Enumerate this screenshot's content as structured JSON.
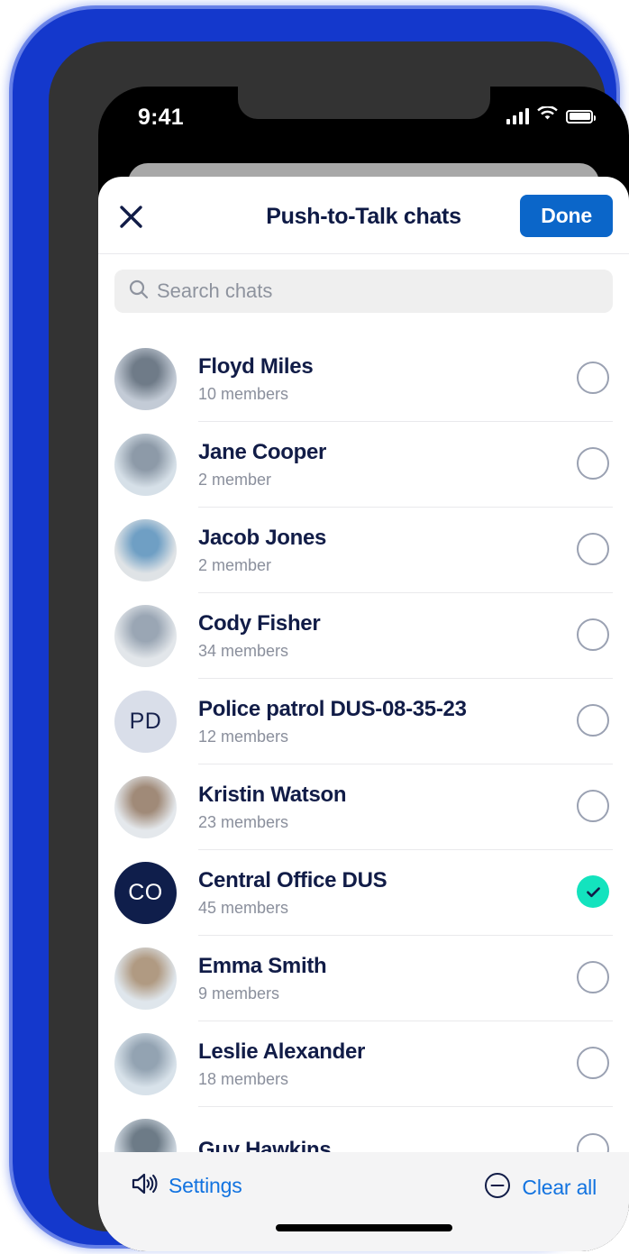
{
  "status_bar": {
    "time": "9:41",
    "signal_icon": "cellular-signal-icon",
    "wifi_icon": "wifi-icon",
    "battery_icon": "battery-icon"
  },
  "header": {
    "title": "Push-to-Talk chats",
    "close_icon": "close-icon",
    "done_label": "Done"
  },
  "search": {
    "placeholder": "Search chats",
    "value": "",
    "icon": "search-icon"
  },
  "chats": [
    {
      "name": "Floyd Miles",
      "members": "10 members",
      "selected": false,
      "avatar_type": "photo",
      "initials": "",
      "photo_a": "#c3cbd6",
      "photo_b": "#6f7b88"
    },
    {
      "name": "Jane Cooper",
      "members": "2 member",
      "selected": false,
      "avatar_type": "photo",
      "initials": "",
      "photo_a": "#d6e0e8",
      "photo_b": "#8d9aa8"
    },
    {
      "name": "Jacob Jones",
      "members": "2 member",
      "selected": false,
      "avatar_type": "photo",
      "initials": "",
      "photo_a": "#dfe3e6",
      "photo_b": "#6f9fc4"
    },
    {
      "name": "Cody Fisher",
      "members": "34 members",
      "selected": false,
      "avatar_type": "photo",
      "initials": "",
      "photo_a": "#e2e6ea",
      "photo_b": "#9aa6b4"
    },
    {
      "name": "Police patrol DUS-08-35-23",
      "members": "12 members",
      "selected": false,
      "avatar_type": "initials",
      "initials": "PD",
      "bg": "#D9DEE9",
      "fg": "#17224d"
    },
    {
      "name": "Kristin Watson",
      "members": "23 members",
      "selected": false,
      "avatar_type": "photo",
      "initials": "",
      "photo_a": "#e4e8ec",
      "photo_b": "#a08a78"
    },
    {
      "name": "Central Office DUS",
      "members": "45 members",
      "selected": true,
      "avatar_type": "initials",
      "initials": "CO",
      "bg": "#0F1E4B",
      "fg": "#ffffff"
    },
    {
      "name": "Emma Smith",
      "members": "9 members",
      "selected": false,
      "avatar_type": "photo",
      "initials": "",
      "photo_a": "#dfe6ec",
      "photo_b": "#b09a82"
    },
    {
      "name": "Leslie Alexander",
      "members": "18 members",
      "selected": false,
      "avatar_type": "photo",
      "initials": "",
      "photo_a": "#d8e2ea",
      "photo_b": "#93a3b2"
    },
    {
      "name": "Guy Hawkins",
      "members": "",
      "selected": false,
      "avatar_type": "photo",
      "initials": "",
      "photo_a": "#ccd5de",
      "photo_b": "#6d7b87"
    }
  ],
  "bottom_bar": {
    "settings_label": "Settings",
    "settings_icon": "speaker-volume-icon",
    "clear_all_label": "Clear all",
    "clear_all_icon": "minus-circle-icon"
  },
  "colors": {
    "accent_blue": "#0B66C9",
    "link_blue": "#1273E0",
    "selected_green": "#13E3BE",
    "navy": "#111C47",
    "frame_blue": "#1438CC"
  }
}
